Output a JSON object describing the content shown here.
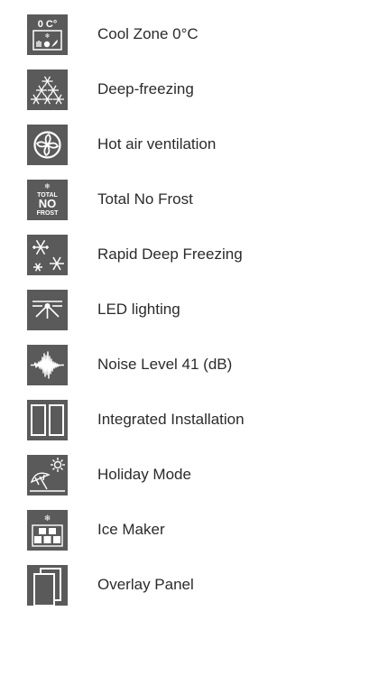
{
  "features": [
    {
      "label": "Cool Zone 0°C",
      "icon": "cool-zone-icon",
      "icon_text": "0 C°"
    },
    {
      "label": "Deep-freezing",
      "icon": "deep-freezing-icon"
    },
    {
      "label": "Hot air ventilation",
      "icon": "fan-icon"
    },
    {
      "label": "Total No Frost",
      "icon": "no-frost-icon",
      "icon_lines": [
        "TOTAL",
        "NO",
        "FROST"
      ]
    },
    {
      "label": "Rapid Deep Freezing",
      "icon": "rapid-freezing-icon"
    },
    {
      "label": "LED lighting",
      "icon": "led-light-icon"
    },
    {
      "label": "Noise Level 41 (dB)",
      "icon": "noise-level-icon"
    },
    {
      "label": "Integrated Installation",
      "icon": "integrated-installation-icon"
    },
    {
      "label": "Holiday Mode",
      "icon": "holiday-mode-icon"
    },
    {
      "label": "Ice Maker",
      "icon": "ice-maker-icon"
    },
    {
      "label": "Overlay Panel",
      "icon": "overlay-panel-icon"
    }
  ],
  "colors": {
    "icon_background": "#5a5a5a",
    "icon_foreground": "#ffffff",
    "label_text": "#2b2b2b"
  }
}
